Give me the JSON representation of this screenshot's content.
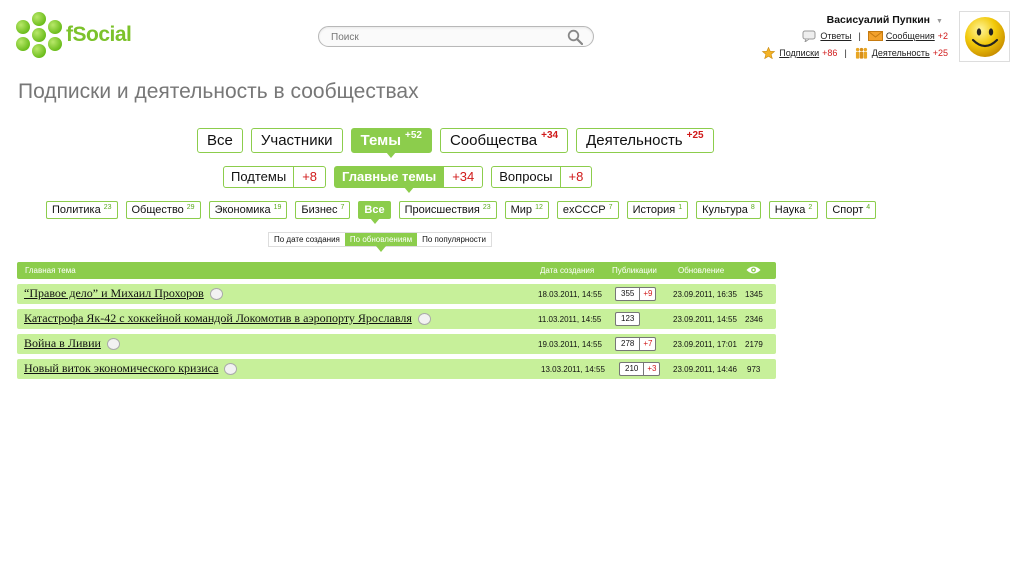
{
  "brand": {
    "name": "fSocial"
  },
  "search": {
    "placeholder": "Поиск"
  },
  "user": {
    "name": "Васисуалий Пупкин",
    "replies_label": "Ответы",
    "messages_label": "Сообщения",
    "messages_count": "+2",
    "subscriptions_label": "Подписки",
    "subscriptions_count": "+86",
    "activity_label": "Деятельность",
    "activity_count": "+25",
    "separator": "|"
  },
  "page_title": "Подписки и деятельность в сообществах",
  "main_tabs": [
    {
      "label": "Все",
      "count": ""
    },
    {
      "label": "Участники",
      "count": ""
    },
    {
      "label": "Темы",
      "count": "+52",
      "active": true
    },
    {
      "label": "Сообщества",
      "count": "+34"
    },
    {
      "label": "Деятельность",
      "count": "+25"
    }
  ],
  "sub_tabs": [
    {
      "label": "Подтемы",
      "count": "+8"
    },
    {
      "label": "Главные темы",
      "count": "+34",
      "active": true
    },
    {
      "label": "Вопросы",
      "count": "+8"
    }
  ],
  "subjects": [
    {
      "label": "Политика",
      "count": "23"
    },
    {
      "label": "Общество",
      "count": "29"
    },
    {
      "label": "Экономика",
      "count": "19"
    },
    {
      "label": "Бизнес",
      "count": "7"
    },
    {
      "label": "Все",
      "count": "",
      "active": true
    },
    {
      "label": "Происшествия",
      "count": "23"
    },
    {
      "label": "Мир",
      "count": "12"
    },
    {
      "label": "exСССР",
      "count": "7"
    },
    {
      "label": "История",
      "count": "1"
    },
    {
      "label": "Культура",
      "count": "8"
    },
    {
      "label": "Наука",
      "count": "2"
    },
    {
      "label": "Спорт",
      "count": "4"
    }
  ],
  "sort": [
    {
      "label": "По дате создания"
    },
    {
      "label": "По обновлениям",
      "active": true
    },
    {
      "label": "По популярности"
    }
  ],
  "table": {
    "headers": {
      "topic": "Главная тема",
      "created": "Дата создания",
      "publications": "Публикации",
      "updated": "Обновление"
    },
    "rows": [
      {
        "topic": "“Правое дело” и Михаил Прохоров",
        "created": "18.03.2011, 14:55",
        "pubs": "355",
        "pubs_new": "+9",
        "updated": "23.09.2011, 16:35",
        "views": "1345"
      },
      {
        "topic": "Катастрофа Як-42 с хоккейной командой Локомотив в аэропорту Ярославля",
        "created": "11.03.2011, 14:55",
        "pubs": "123",
        "pubs_new": "",
        "updated": "23.09.2011, 14:55",
        "views": "2346"
      },
      {
        "topic": "Война в Ливии",
        "created": "19.03.2011, 14:55",
        "pubs": "278",
        "pubs_new": "+7",
        "updated": "23.09.2011, 17:01",
        "views": "2179"
      },
      {
        "topic": "Новый виток экономического кризиса",
        "created": "13.03.2011, 14:55",
        "pubs": "210",
        "pubs_new": "+3",
        "updated": "23.09.2011, 14:46",
        "views": "973"
      }
    ]
  },
  "colors": {
    "accent": "#8ccd4c",
    "row": "#c7f09a",
    "count": "#d01a1a"
  }
}
